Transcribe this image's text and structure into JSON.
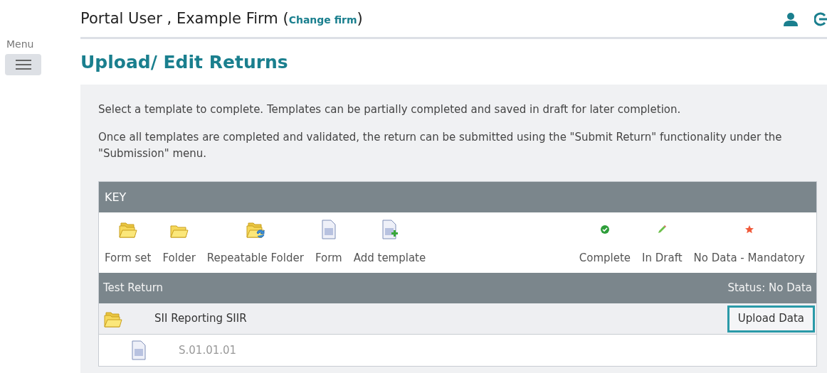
{
  "header": {
    "user": "Portal User , Example Firm (",
    "change_link": "Change firm",
    "close": ")"
  },
  "sidebar": {
    "menu_label": "Menu"
  },
  "page_title": "Upload/ Edit Returns",
  "intro": [
    "Select a template to complete. Templates can be partially completed and saved in draft for later completion.",
    "Once all templates are completed and validated, the return can be submitted using the \"Submit Return\" functionality under the \"Submission\" menu."
  ],
  "key": {
    "title": "KEY",
    "items": [
      {
        "kind": "formset",
        "label": "Form set"
      },
      {
        "kind": "folder",
        "label": "Folder"
      },
      {
        "kind": "repeatable",
        "label": "Repeatable Folder"
      },
      {
        "kind": "form",
        "label": "Form"
      },
      {
        "kind": "add",
        "label": "Add template"
      },
      {
        "kind": "complete",
        "label": "Complete"
      },
      {
        "kind": "draft",
        "label": "In Draft"
      },
      {
        "kind": "mandatory",
        "label": "No Data - Mandatory"
      }
    ]
  },
  "return": {
    "name": "Test Return",
    "status": "Status: No Data",
    "rows": [
      {
        "kind": "formset",
        "label": "SII Reporting SIIR",
        "action": "Upload Data",
        "children": [
          {
            "kind": "form",
            "label": "S.01.01.01"
          }
        ]
      }
    ]
  }
}
